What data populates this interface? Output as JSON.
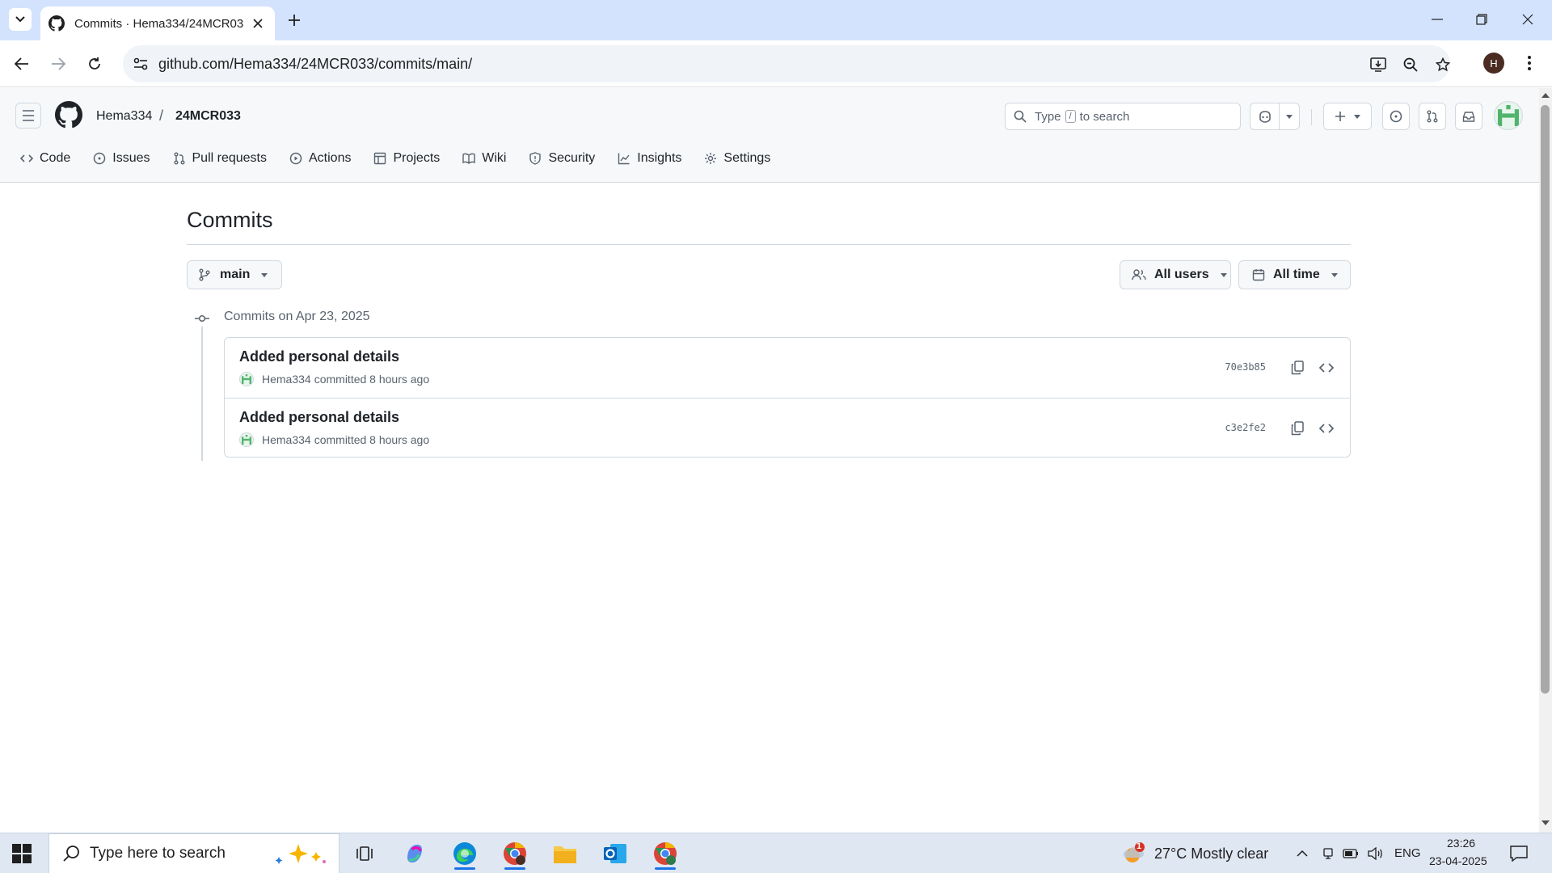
{
  "browser": {
    "tab_title": "Commits · Hema334/24MCR033",
    "url": "github.com/Hema334/24MCR033/commits/main/",
    "profile_initial": "H"
  },
  "github": {
    "owner": "Hema334",
    "repo": "24MCR033",
    "search": {
      "prefix": "Type",
      "key": "/",
      "suffix": "to search"
    },
    "nav": [
      {
        "label": "Code",
        "icon": "code-icon"
      },
      {
        "label": "Issues",
        "icon": "issue-icon"
      },
      {
        "label": "Pull requests",
        "icon": "pull-request-icon"
      },
      {
        "label": "Actions",
        "icon": "play-icon"
      },
      {
        "label": "Projects",
        "icon": "table-icon"
      },
      {
        "label": "Wiki",
        "icon": "book-icon"
      },
      {
        "label": "Security",
        "icon": "shield-icon"
      },
      {
        "label": "Insights",
        "icon": "graph-icon"
      },
      {
        "label": "Settings",
        "icon": "gear-icon"
      }
    ]
  },
  "page": {
    "title": "Commits",
    "branch": "main",
    "users_filter": "All users",
    "time_filter": "All time",
    "group_label": "Commits on Apr 23, 2025",
    "commits": [
      {
        "message": "Added personal details",
        "author": "Hema334",
        "meta": "committed 8 hours ago",
        "sha": "70e3b85"
      },
      {
        "message": "Added personal details",
        "author": "Hema334",
        "meta": "committed 8 hours ago",
        "sha": "c3e2fe2"
      }
    ]
  },
  "taskbar": {
    "search_placeholder": "Type here to search",
    "weather": "27°C  Mostly clear",
    "weather_badge": "1",
    "language": "ENG",
    "time": "23:26",
    "date": "23-04-2025"
  },
  "colors": {
    "accent": "#0969da",
    "header_bg": "#f6f8fa",
    "border": "#d1d9e0",
    "chrome_tabbar": "#d3e3fd"
  }
}
